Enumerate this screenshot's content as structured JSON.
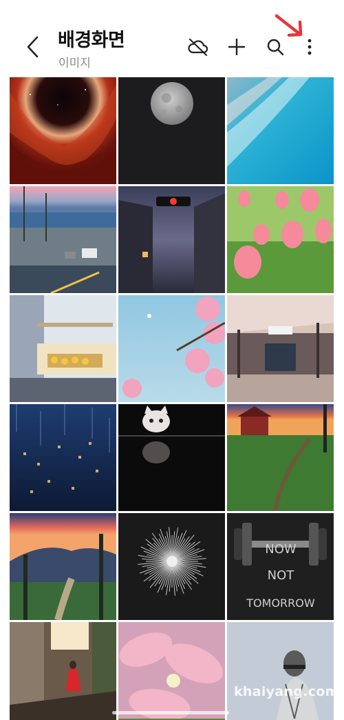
{
  "header": {
    "title": "배경화면",
    "subtitle": "이미지",
    "icons": [
      "back-icon",
      "cloud-off-icon",
      "plus-icon",
      "search-icon",
      "more-vert-icon"
    ]
  },
  "annotation": {
    "arrow_color": "#e8353a"
  },
  "gallery": {
    "images": [
      {
        "name": "red-nebula"
      },
      {
        "name": "full-moon"
      },
      {
        "name": "ocean-wave"
      },
      {
        "name": "coastal-street"
      },
      {
        "name": "alley-traffic-light"
      },
      {
        "name": "pink-tulips"
      },
      {
        "name": "blossom-fruit-stand"
      },
      {
        "name": "cherry-blossom-sky"
      },
      {
        "name": "train-station"
      },
      {
        "name": "rainy-city-night"
      },
      {
        "name": "cat-reflection"
      },
      {
        "name": "red-barn-sunset"
      },
      {
        "name": "valley-road-sunset"
      },
      {
        "name": "fireworks"
      },
      {
        "name": "dumbbell-poster"
      },
      {
        "name": "woman-red-dress-alley"
      },
      {
        "name": "pink-lily"
      },
      {
        "name": "man-sketch"
      }
    ],
    "poster_text": [
      "NOW",
      "NOT",
      "TOMORROW"
    ]
  },
  "watermark": "khaiyang.com"
}
